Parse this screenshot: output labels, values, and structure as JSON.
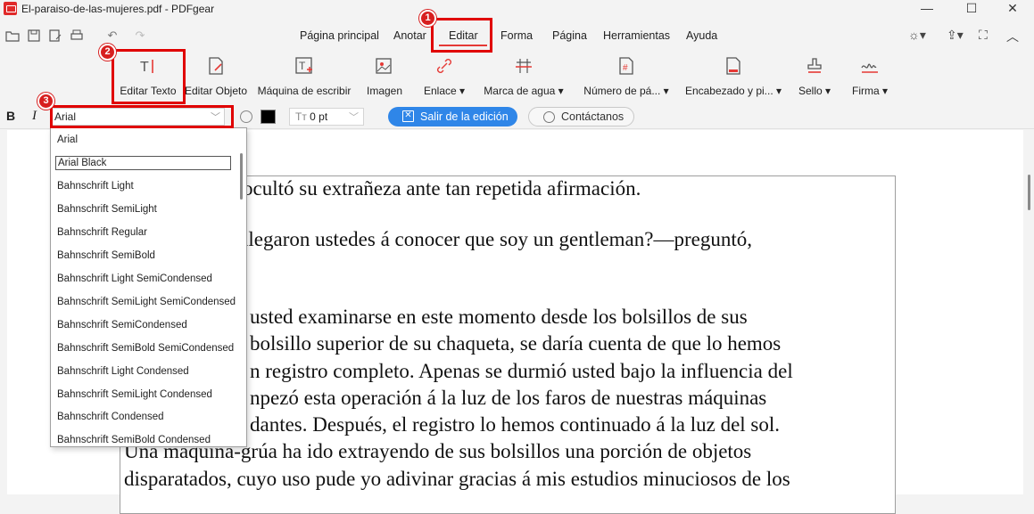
{
  "window": {
    "title": "El-paraiso-de-las-mujeres.pdf - PDFgear",
    "minimize": "—",
    "maximize": "☐",
    "close": "✕"
  },
  "menu": {
    "items": [
      "Página principal",
      "Anotar",
      "Editar",
      "Forma",
      "Página",
      "Herramientas",
      "Ayuda"
    ],
    "active": "Editar"
  },
  "toolbar": {
    "tools": [
      {
        "label": "Editar Texto"
      },
      {
        "label": "Editar Objeto"
      },
      {
        "label": "Máquina de escribir"
      },
      {
        "label": "Imagen"
      },
      {
        "label": "Enlace ▾"
      },
      {
        "label": "Marca de agua ▾"
      },
      {
        "label": "Número de pá... ▾"
      },
      {
        "label": "Encabezado y pi... ▾"
      },
      {
        "label": "Sello ▾"
      },
      {
        "label": "Firma ▾"
      }
    ]
  },
  "format": {
    "bold": "B",
    "italic": "I",
    "font_value": "Arial",
    "size_value": "0 pt",
    "exit_label": "Salir de la edición",
    "contact_label": "Contáctanos"
  },
  "font_dropdown": {
    "items": [
      "Arial",
      "Arial Black",
      "Bahnschrift Light",
      "Bahnschrift SemiLight",
      "Bahnschrift Regular",
      "Bahnschrift SemiBold",
      "Bahnschrift Light SemiCondensed",
      "Bahnschrift SemiLight SemiCondensed",
      "Bahnschrift SemiCondensed",
      "Bahnschrift SemiBold SemiCondensed",
      "Bahnschrift Light Condensed",
      "Bahnschrift SemiLight Condensed",
      "Bahnschrift Condensed",
      "Bahnschrift SemiBold Condensed"
    ],
    "highlighted": "Arial Black"
  },
  "document": {
    "lines": [
      "ocultó su extrañeza ante tan repetida afirmación.",
      "llegaron ustedes á conocer que soy un gentleman?—preguntó,",
      "usted examinarse en este momento desde los bolsillos de sus",
      "bolsillo superior de su chaqueta, se daría cuenta de que lo hemos",
      "n registro completo. Apenas se durmió usted bajo la influencia del",
      "npezó esta operación á la luz de los faros de nuestras máquinas",
      "dantes. Después, el registro lo hemos continuado á la luz del sol.",
      "Una máquina-grúa ha ido extrayendo de sus bolsillos una porción de objetos",
      "disparatados, cuyo uso pude yo adivinar gracias á mis estudios minuciosos de los"
    ]
  },
  "annotations": [
    "1",
    "2",
    "3"
  ],
  "colors": {
    "accent_red": "#e00000",
    "primary_blue": "#2f86e8"
  }
}
